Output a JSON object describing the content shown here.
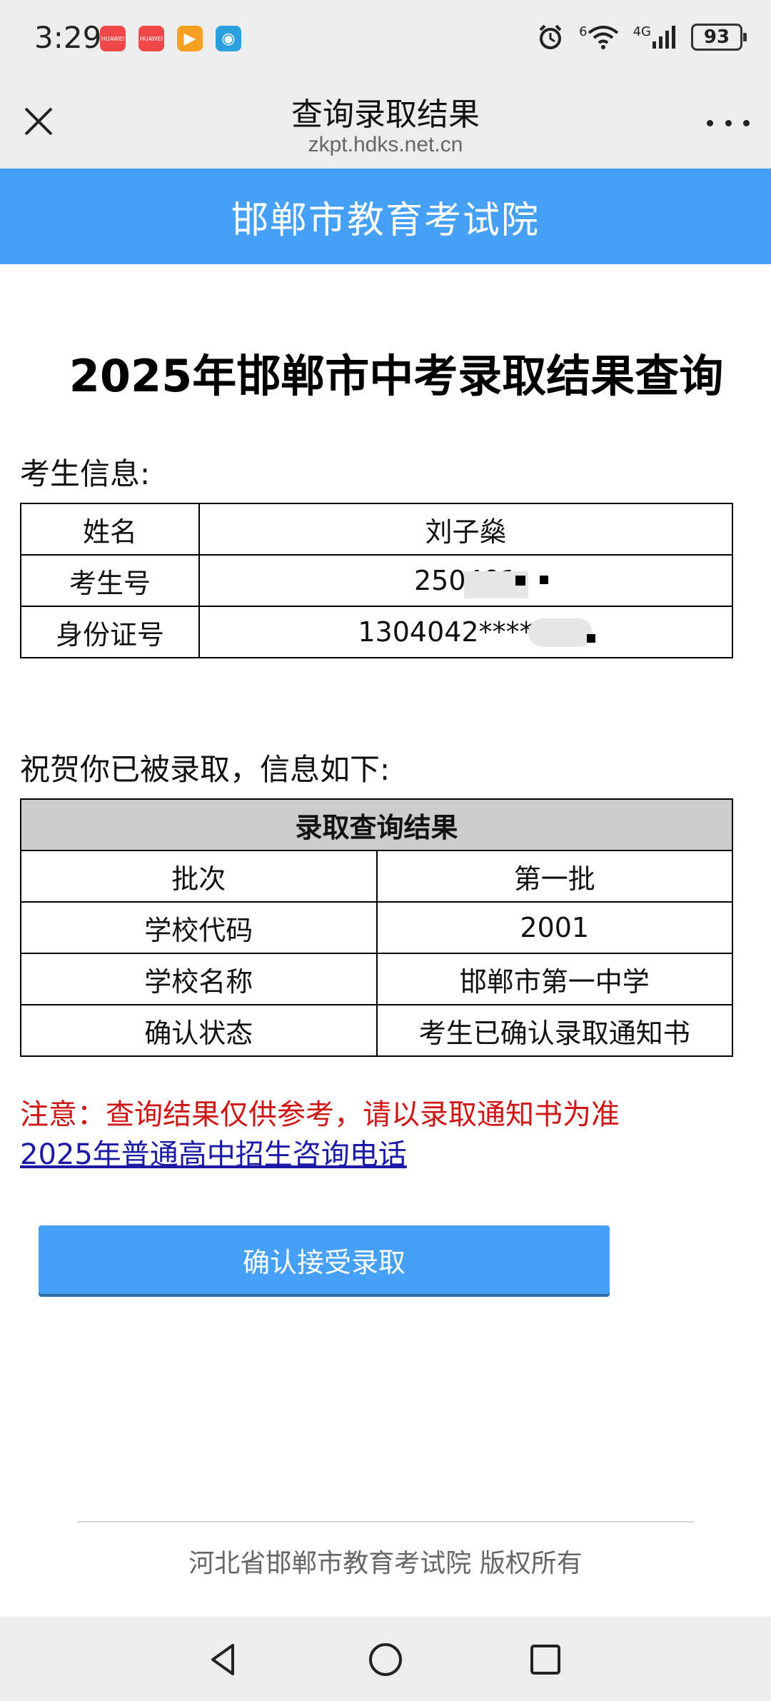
{
  "status_bar": {
    "time": "3:29",
    "app_icons": [
      {
        "name": "huawei-app-icon-1",
        "color": "#f04848",
        "label": "HUAWEI"
      },
      {
        "name": "huawei-app-icon-2",
        "color": "#f04848",
        "label": "HUAWEI"
      },
      {
        "name": "video-app-icon",
        "color": "#f5a020",
        "label": "▶"
      },
      {
        "name": "browser-app-icon",
        "color": "#2aa0e0",
        "label": "◉"
      }
    ],
    "network": "4G",
    "wifi_label": "6",
    "battery": "93"
  },
  "browser": {
    "title": "查询录取结果",
    "url": "zkpt.hdks.net.cn"
  },
  "site_banner": "邯郸市教育考试院",
  "main_heading": "2025年邯郸市中考录取结果查询",
  "candidate_section": {
    "label": "考生信息:",
    "rows": [
      {
        "key": "姓名",
        "value": "刘子燊"
      },
      {
        "key": "考生号",
        "value": "250401"
      },
      {
        "key": "身份证号",
        "value": "1304042*******"
      }
    ]
  },
  "congrats_label": "祝贺你已被录取，信息如下:",
  "result_table": {
    "title": "录取查询结果",
    "rows": [
      {
        "key": "批次",
        "value": "第一批"
      },
      {
        "key": "学校代码",
        "value": "2001"
      },
      {
        "key": "学校名称",
        "value": "邯郸市第一中学"
      },
      {
        "key": "确认状态",
        "value": "考生已确认录取通知书"
      }
    ]
  },
  "notice": "注意：查询结果仅供参考，请以录取通知书为准",
  "hotline_link": "2025年普通高中招生咨询电话",
  "accept_button": "确认接受录取",
  "footer": "河北省邯郸市教育考试院 版权所有",
  "colors": {
    "banner": "#46a0f5",
    "notice": "#d01515",
    "link": "#1a1aa6"
  }
}
